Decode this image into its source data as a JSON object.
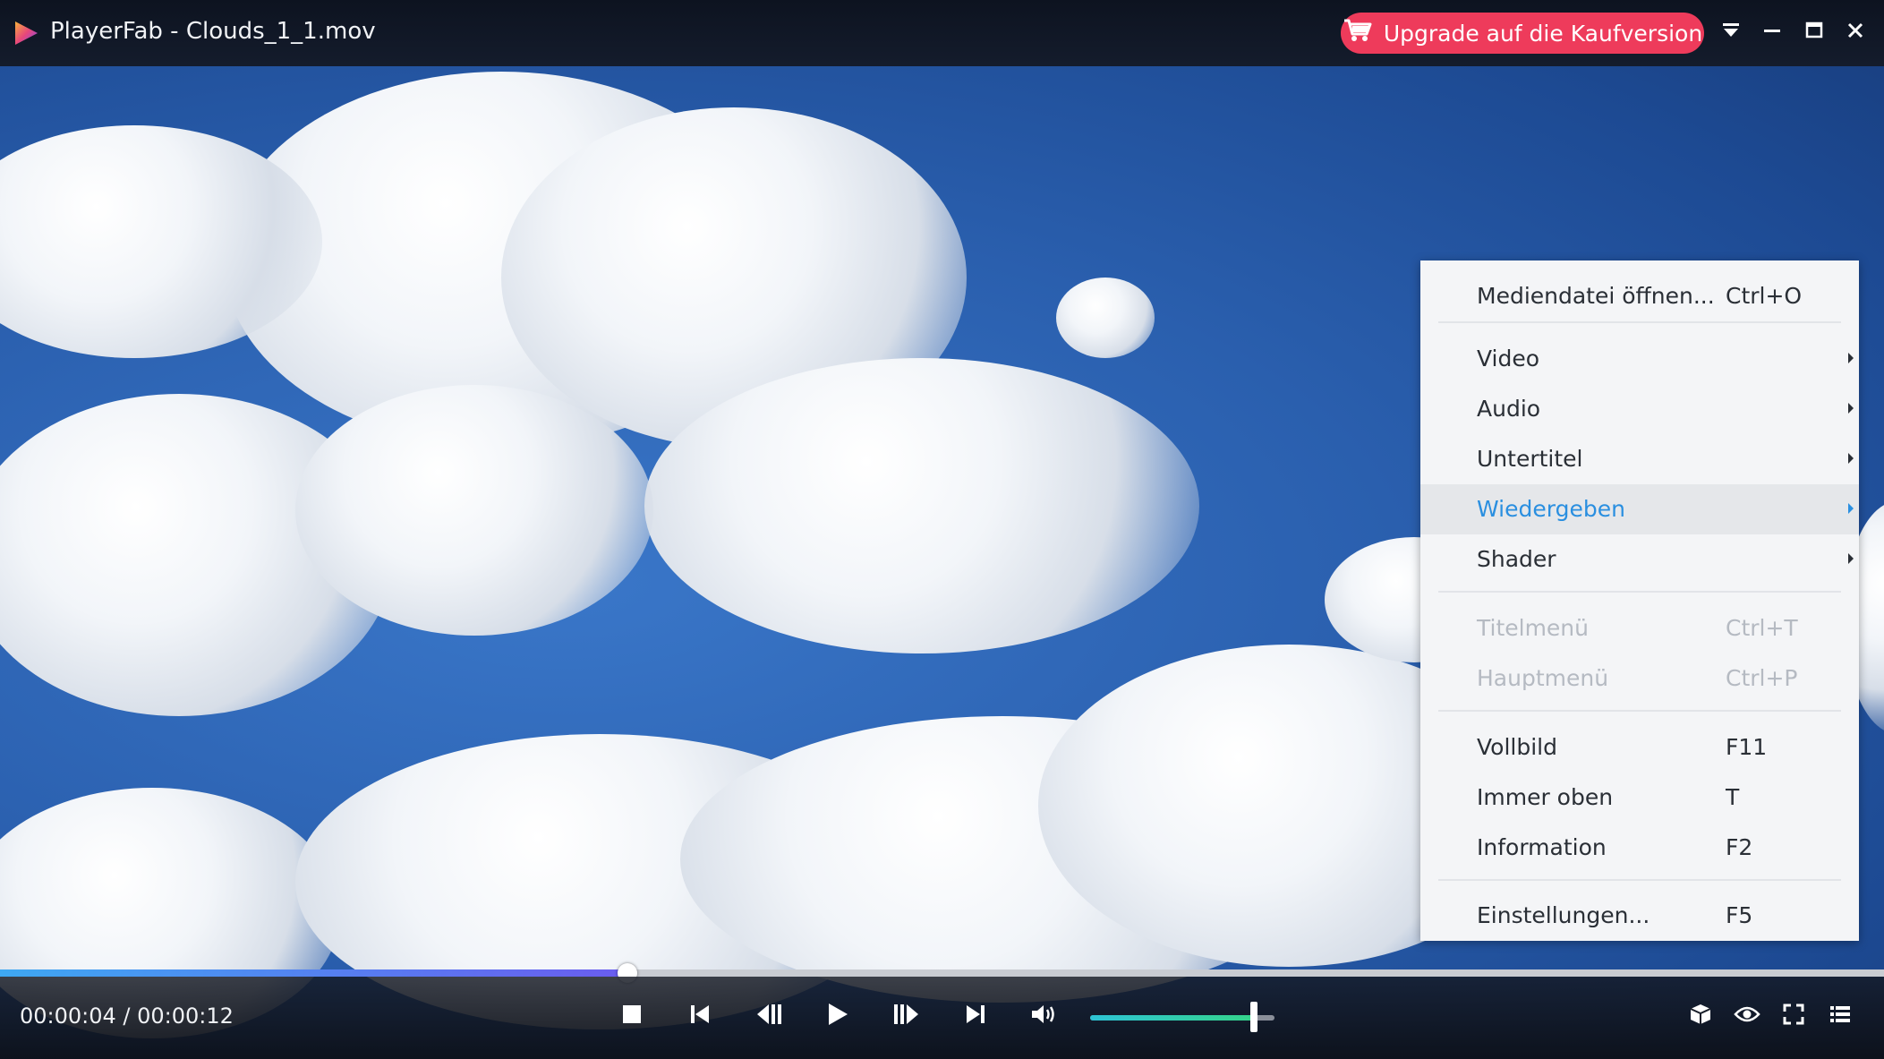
{
  "window": {
    "title": "PlayerFab - Clouds_1_1.mov",
    "upgrade_label": "Upgrade auf die Kaufversion"
  },
  "menu": {
    "items": [
      {
        "label": "Mediendatei öffnen...",
        "shortcut": "Ctrl+O"
      },
      {
        "label": "Video",
        "submenu": true
      },
      {
        "label": "Audio",
        "submenu": true
      },
      {
        "label": "Untertitel",
        "submenu": true
      },
      {
        "label": "Wiedergeben",
        "submenu": true,
        "active": true
      },
      {
        "label": "Shader",
        "submenu": true
      },
      {
        "label": "Titelmenü",
        "shortcut": "Ctrl+T",
        "disabled": true
      },
      {
        "label": "Hauptmenü",
        "shortcut": "Ctrl+P",
        "disabled": true
      },
      {
        "label": "Vollbild",
        "shortcut": "F11"
      },
      {
        "label": "Immer oben",
        "shortcut": "T"
      },
      {
        "label": "Information",
        "shortcut": "F2"
      },
      {
        "label": "Einstellungen...",
        "shortcut": "F5"
      }
    ]
  },
  "player": {
    "time_display": "00:00:04 / 00:00:12",
    "progress_fraction": 0.333,
    "volume_fraction": 0.89
  },
  "colors": {
    "upgrade": "#ee3b5b",
    "menu_highlight": "#2a8fe0"
  }
}
